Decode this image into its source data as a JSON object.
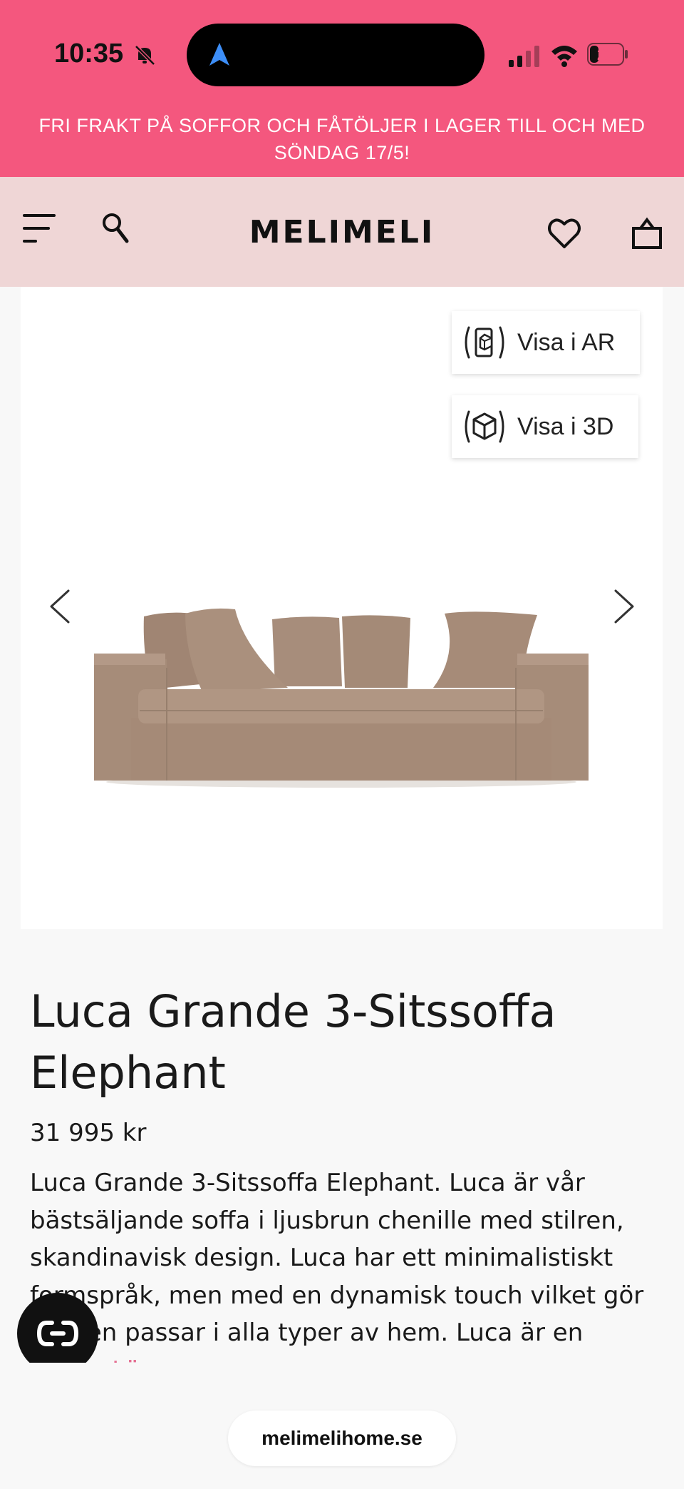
{
  "status_bar": {
    "time": "10:35",
    "battery": "22"
  },
  "promo": {
    "text": "FRI FRAKT PÅ SOFFOR OCH FÅTÖLJER I LAGER TILL OCH MED SÖNDAG 17/5!"
  },
  "header": {
    "logo": "MELIMELI"
  },
  "gallery": {
    "ar_label": "Visa i AR",
    "view3d_label": "Visa i 3D"
  },
  "product": {
    "title": "Luca Grande 3-Sitssoffa Elephant",
    "price": "31 995 kr",
    "description": "Luca Grande 3-Sitssoffa Elephant. Luca är vår bästsäljande soffa i ljusbrun chenille med stilren, skandinavisk design. Luca har ett minimalistiskt formspråk, men med en dynamisk touch vilket gör att den passar i alla typer av hem. Luca är en stor...",
    "read_more": "Läs mer >"
  },
  "browser": {
    "url": "melimelihome.se"
  },
  "colors": {
    "accent": "#f4577e",
    "header_bg": "#efd6d6",
    "link": "#e56f92"
  }
}
